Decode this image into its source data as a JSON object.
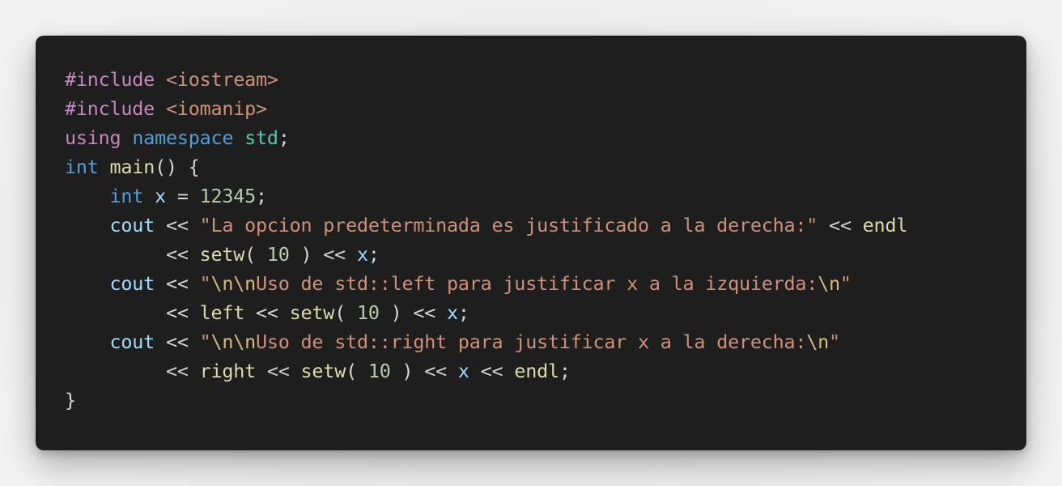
{
  "editor": {
    "theme": {
      "background": "#1e1e1e",
      "keyword": "#c586c0",
      "type": "#569cd6",
      "namespace": "#4ec9b0",
      "string": "#ce9178",
      "escape": "#d7ba7d",
      "number": "#b5cea8",
      "variable": "#9cdcfe",
      "function": "#dcdcaa",
      "default": "#d4d4d4"
    },
    "lines": [
      [
        {
          "t": "kw",
          "v": "#include"
        },
        {
          "t": "op",
          "v": " "
        },
        {
          "t": "str",
          "v": "<iostream>"
        }
      ],
      [
        {
          "t": "kw",
          "v": "#include"
        },
        {
          "t": "op",
          "v": " "
        },
        {
          "t": "str",
          "v": "<iomanip>"
        }
      ],
      [
        {
          "t": "kw",
          "v": "using"
        },
        {
          "t": "op",
          "v": " "
        },
        {
          "t": "type",
          "v": "namespace"
        },
        {
          "t": "op",
          "v": " "
        },
        {
          "t": "ns",
          "v": "std"
        },
        {
          "t": "punc",
          "v": ";"
        }
      ],
      [
        {
          "t": "type",
          "v": "int"
        },
        {
          "t": "op",
          "v": " "
        },
        {
          "t": "fn",
          "v": "main"
        },
        {
          "t": "punc",
          "v": "() {"
        }
      ],
      [
        {
          "t": "op",
          "v": "    "
        },
        {
          "t": "type",
          "v": "int"
        },
        {
          "t": "op",
          "v": " "
        },
        {
          "t": "var",
          "v": "x"
        },
        {
          "t": "op",
          "v": " = "
        },
        {
          "t": "num",
          "v": "12345"
        },
        {
          "t": "punc",
          "v": ";"
        }
      ],
      [
        {
          "t": "op",
          "v": "    "
        },
        {
          "t": "var",
          "v": "cout"
        },
        {
          "t": "op",
          "v": " << "
        },
        {
          "t": "str",
          "v": "\"La opcion predeterminada es justificado a la derecha:\""
        },
        {
          "t": "op",
          "v": " << "
        },
        {
          "t": "fn",
          "v": "endl"
        }
      ],
      [
        {
          "t": "op",
          "v": "         << "
        },
        {
          "t": "fn",
          "v": "setw"
        },
        {
          "t": "punc",
          "v": "( "
        },
        {
          "t": "num",
          "v": "10"
        },
        {
          "t": "punc",
          "v": " )"
        },
        {
          "t": "op",
          "v": " << "
        },
        {
          "t": "var",
          "v": "x"
        },
        {
          "t": "punc",
          "v": ";"
        }
      ],
      [
        {
          "t": "op",
          "v": "    "
        },
        {
          "t": "var",
          "v": "cout"
        },
        {
          "t": "op",
          "v": " << "
        },
        {
          "t": "str",
          "v": "\""
        },
        {
          "t": "esc",
          "v": "\\n\\n"
        },
        {
          "t": "str",
          "v": "Uso de std::left para justificar x a la izquierda:"
        },
        {
          "t": "esc",
          "v": "\\n"
        },
        {
          "t": "str",
          "v": "\""
        }
      ],
      [
        {
          "t": "op",
          "v": "         << "
        },
        {
          "t": "fn",
          "v": "left"
        },
        {
          "t": "op",
          "v": " << "
        },
        {
          "t": "fn",
          "v": "setw"
        },
        {
          "t": "punc",
          "v": "( "
        },
        {
          "t": "num",
          "v": "10"
        },
        {
          "t": "punc",
          "v": " )"
        },
        {
          "t": "op",
          "v": " << "
        },
        {
          "t": "var",
          "v": "x"
        },
        {
          "t": "punc",
          "v": ";"
        }
      ],
      [
        {
          "t": "op",
          "v": "    "
        },
        {
          "t": "var",
          "v": "cout"
        },
        {
          "t": "op",
          "v": " << "
        },
        {
          "t": "str",
          "v": "\""
        },
        {
          "t": "esc",
          "v": "\\n\\n"
        },
        {
          "t": "str",
          "v": "Uso de std::right para justificar x a la derecha:"
        },
        {
          "t": "esc",
          "v": "\\n"
        },
        {
          "t": "str",
          "v": "\""
        }
      ],
      [
        {
          "t": "op",
          "v": "         << "
        },
        {
          "t": "fn",
          "v": "right"
        },
        {
          "t": "op",
          "v": " << "
        },
        {
          "t": "fn",
          "v": "setw"
        },
        {
          "t": "punc",
          "v": "( "
        },
        {
          "t": "num",
          "v": "10"
        },
        {
          "t": "punc",
          "v": " )"
        },
        {
          "t": "op",
          "v": " << "
        },
        {
          "t": "var",
          "v": "x"
        },
        {
          "t": "op",
          "v": " << "
        },
        {
          "t": "fn",
          "v": "endl"
        },
        {
          "t": "punc",
          "v": ";"
        }
      ],
      [
        {
          "t": "punc",
          "v": "}"
        }
      ]
    ]
  }
}
